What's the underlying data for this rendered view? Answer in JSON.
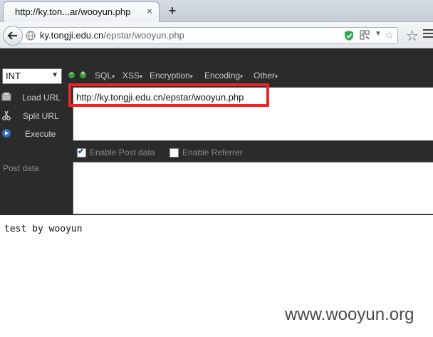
{
  "tab": {
    "title": "http://ky.ton...ar/wooyun.php",
    "close": "×"
  },
  "new_tab": "+",
  "address": {
    "host": "ky.tongji.edu.cn",
    "path": "/epstar/wooyun.php"
  },
  "hackbar": {
    "encoding_select": "INT",
    "menus": [
      "SQL",
      "XSS",
      "Encryption",
      "Encoding",
      "Other"
    ],
    "actions": {
      "load_url": "Load URL",
      "split_url": "Split URL",
      "execute": "Execute"
    },
    "url_value": "http://ky.tongji.edu.cn/epstar/wooyun.php",
    "enable_post_label": "Enable Post data",
    "enable_post_checked": true,
    "enable_referrer_label": "Enable Referrer",
    "enable_referrer_checked": false,
    "post_label": "Post data"
  },
  "page_content": "test by wooyun",
  "watermark": "www.wooyun.org",
  "colors": {
    "highlight": "#e8262b",
    "hackbar_bg": "#2b2b2b"
  }
}
